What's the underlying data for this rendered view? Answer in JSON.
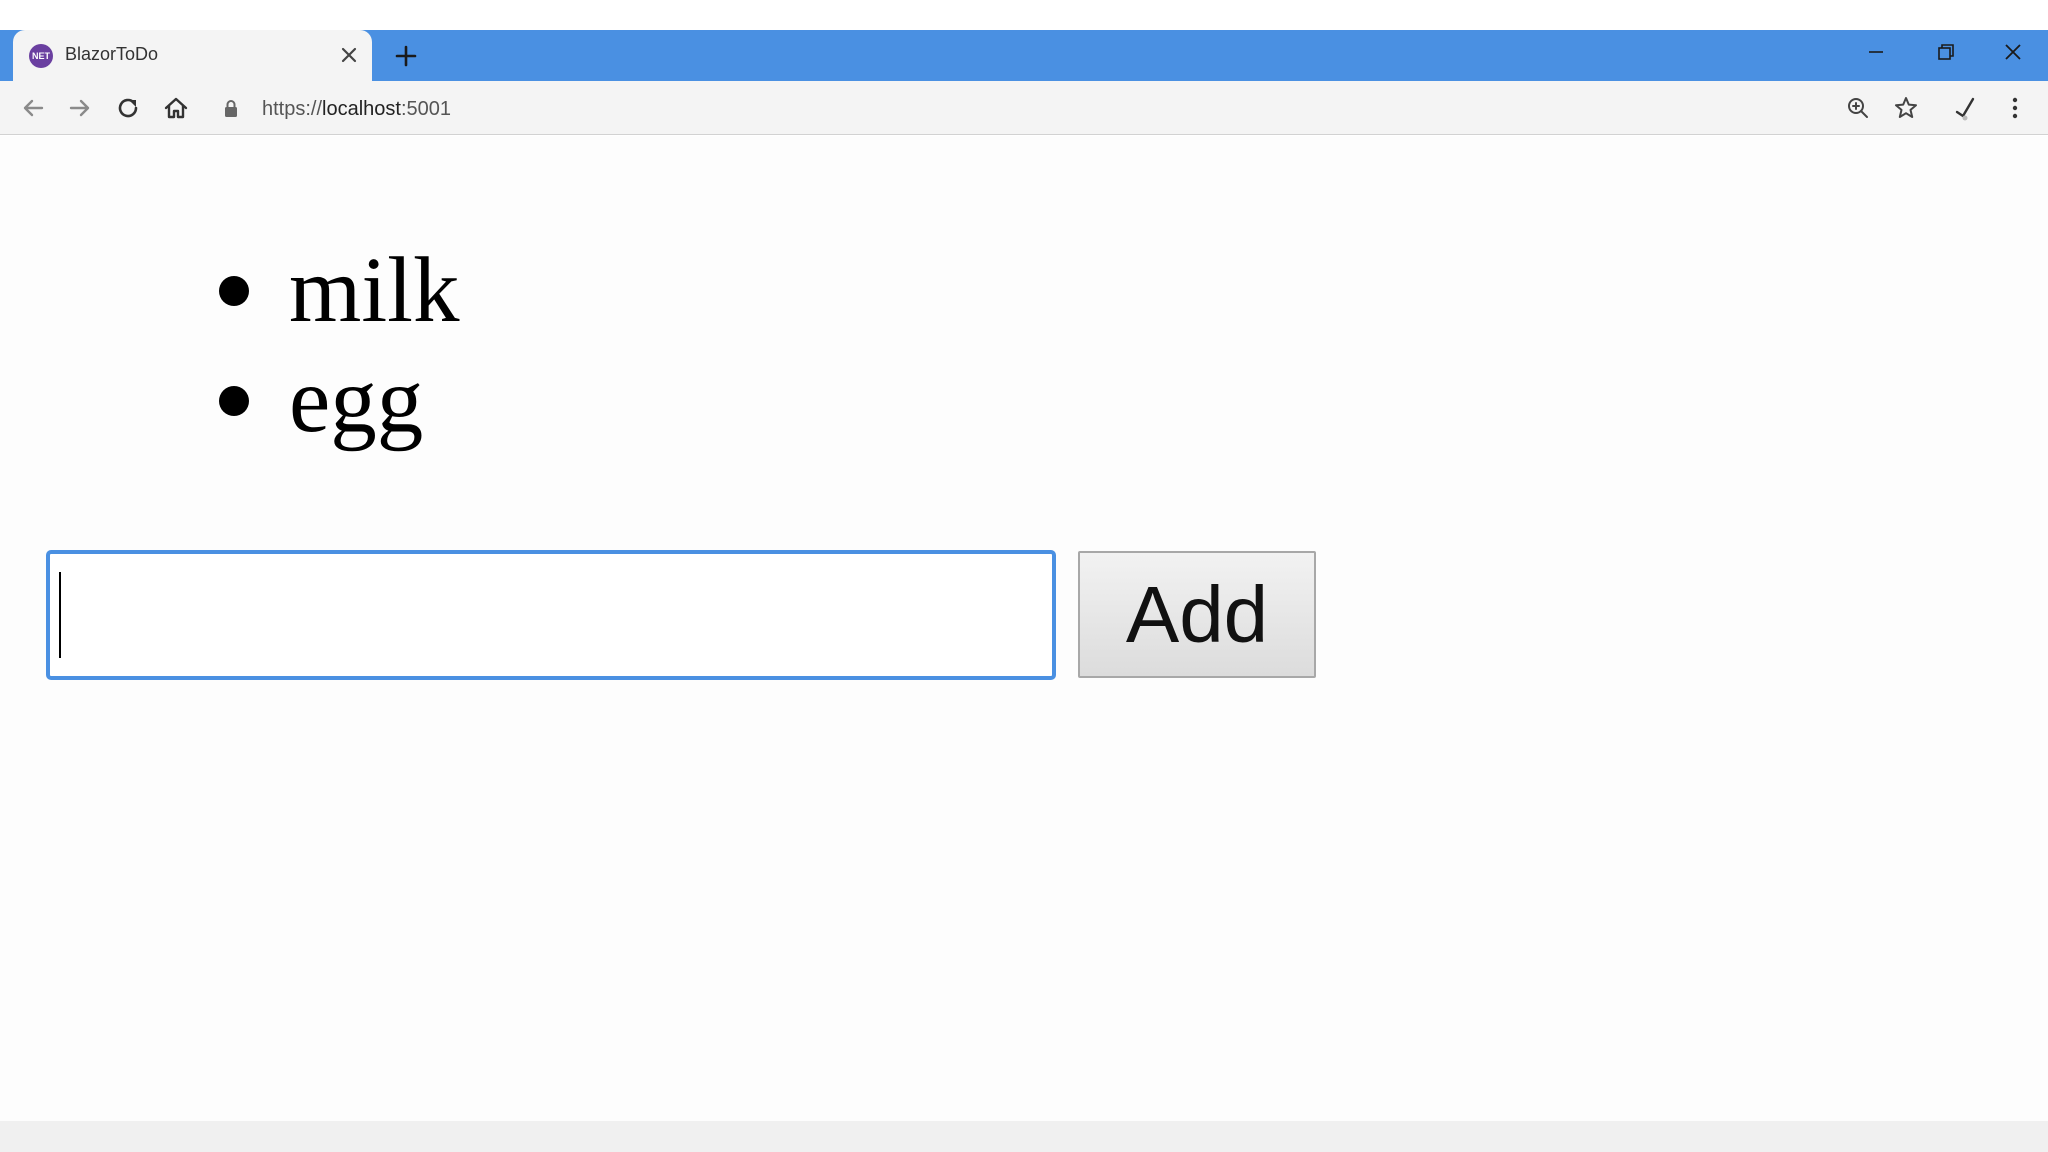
{
  "browser": {
    "tab": {
      "favicon_text": "NET",
      "title": "BlazorToDo"
    },
    "address": {
      "scheme": "https://",
      "host": "localhost",
      "port": ":5001"
    },
    "accent_color": "#4a90e2"
  },
  "icons": {
    "favicon": "blazor-favicon-icon",
    "tab_close": "close-icon",
    "new_tab": "plus-icon",
    "minimize": "minimize-icon",
    "restore": "restore-icon",
    "window_close": "close-icon",
    "back": "back-arrow-icon",
    "forward": "forward-arrow-icon",
    "reload": "reload-icon",
    "home": "home-icon",
    "lock": "lock-icon",
    "zoom": "zoom-icon",
    "bookmark": "star-icon",
    "extension": "extension-icon",
    "menu": "kebab-menu-icon"
  },
  "page": {
    "todos": [
      "milk",
      "egg"
    ],
    "input": {
      "value": "",
      "placeholder": ""
    },
    "add_button_label": "Add"
  }
}
